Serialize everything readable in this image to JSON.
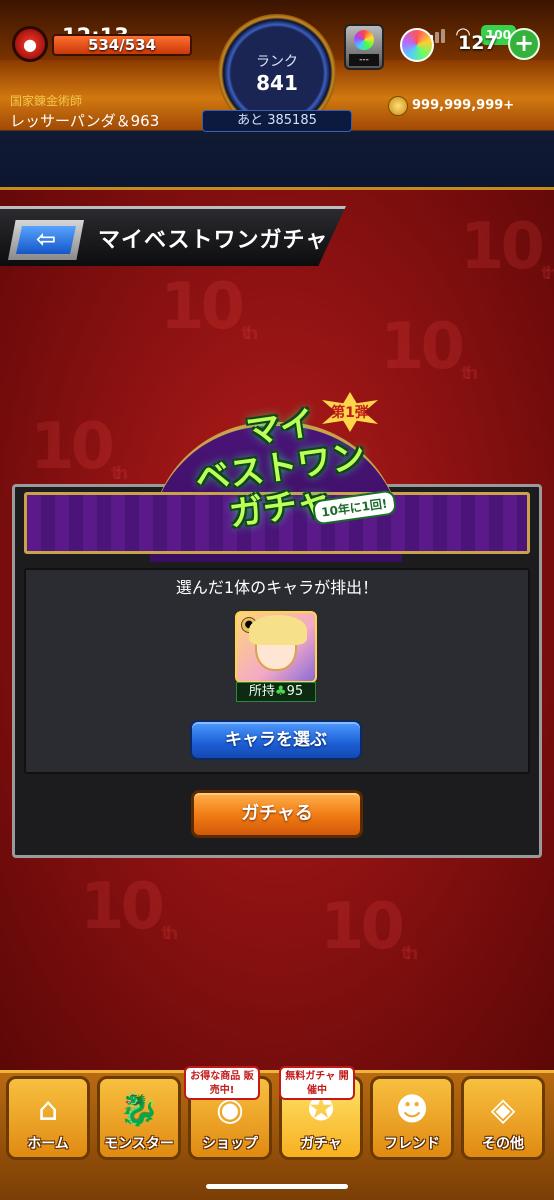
{
  "status_bar": {
    "time": "12:13",
    "battery": "100"
  },
  "header": {
    "stamina": "534/534",
    "rank_label": "ランク",
    "rank_value": "841",
    "rank_next": "あと 385185",
    "slot_label": "---",
    "orb_count": "127",
    "player_title": "国家錬金術師",
    "player_name": "レッサーパンダ＆963",
    "coin_value": "999,999,999+"
  },
  "page": {
    "title": "マイベストワンガチャ"
  },
  "banner": {
    "badge": "第1弾",
    "line1": "マイ",
    "line2": "ベストワン",
    "line3": "ガチャ",
    "sub": "10年に1回!"
  },
  "gacha": {
    "info_text": "選んだ1体のキャラが排出！",
    "owned_label": "所持",
    "owned_count": "95",
    "select_button": "キャラを選ぶ",
    "gacha_button": "ガチャる"
  },
  "background": {
    "mark": "10",
    "mark_suffix": "th"
  },
  "nav": {
    "items": [
      {
        "label": "ホーム",
        "icon": "home-icon"
      },
      {
        "label": "モンスター",
        "icon": "monster-icon"
      },
      {
        "label": "ショップ",
        "icon": "shop-icon"
      },
      {
        "label": "ガチャ",
        "icon": "gacha-icon"
      },
      {
        "label": "フレンド",
        "icon": "friend-icon"
      },
      {
        "label": "その他",
        "icon": "other-icon"
      }
    ],
    "shop_badge": "お得な商品 販売中!",
    "gacha_badge": "無料ガチャ 開催中"
  },
  "colors": {
    "accent_orange": "#f07a12",
    "accent_blue": "#1c5fd6",
    "background_red": "#8e1212"
  }
}
